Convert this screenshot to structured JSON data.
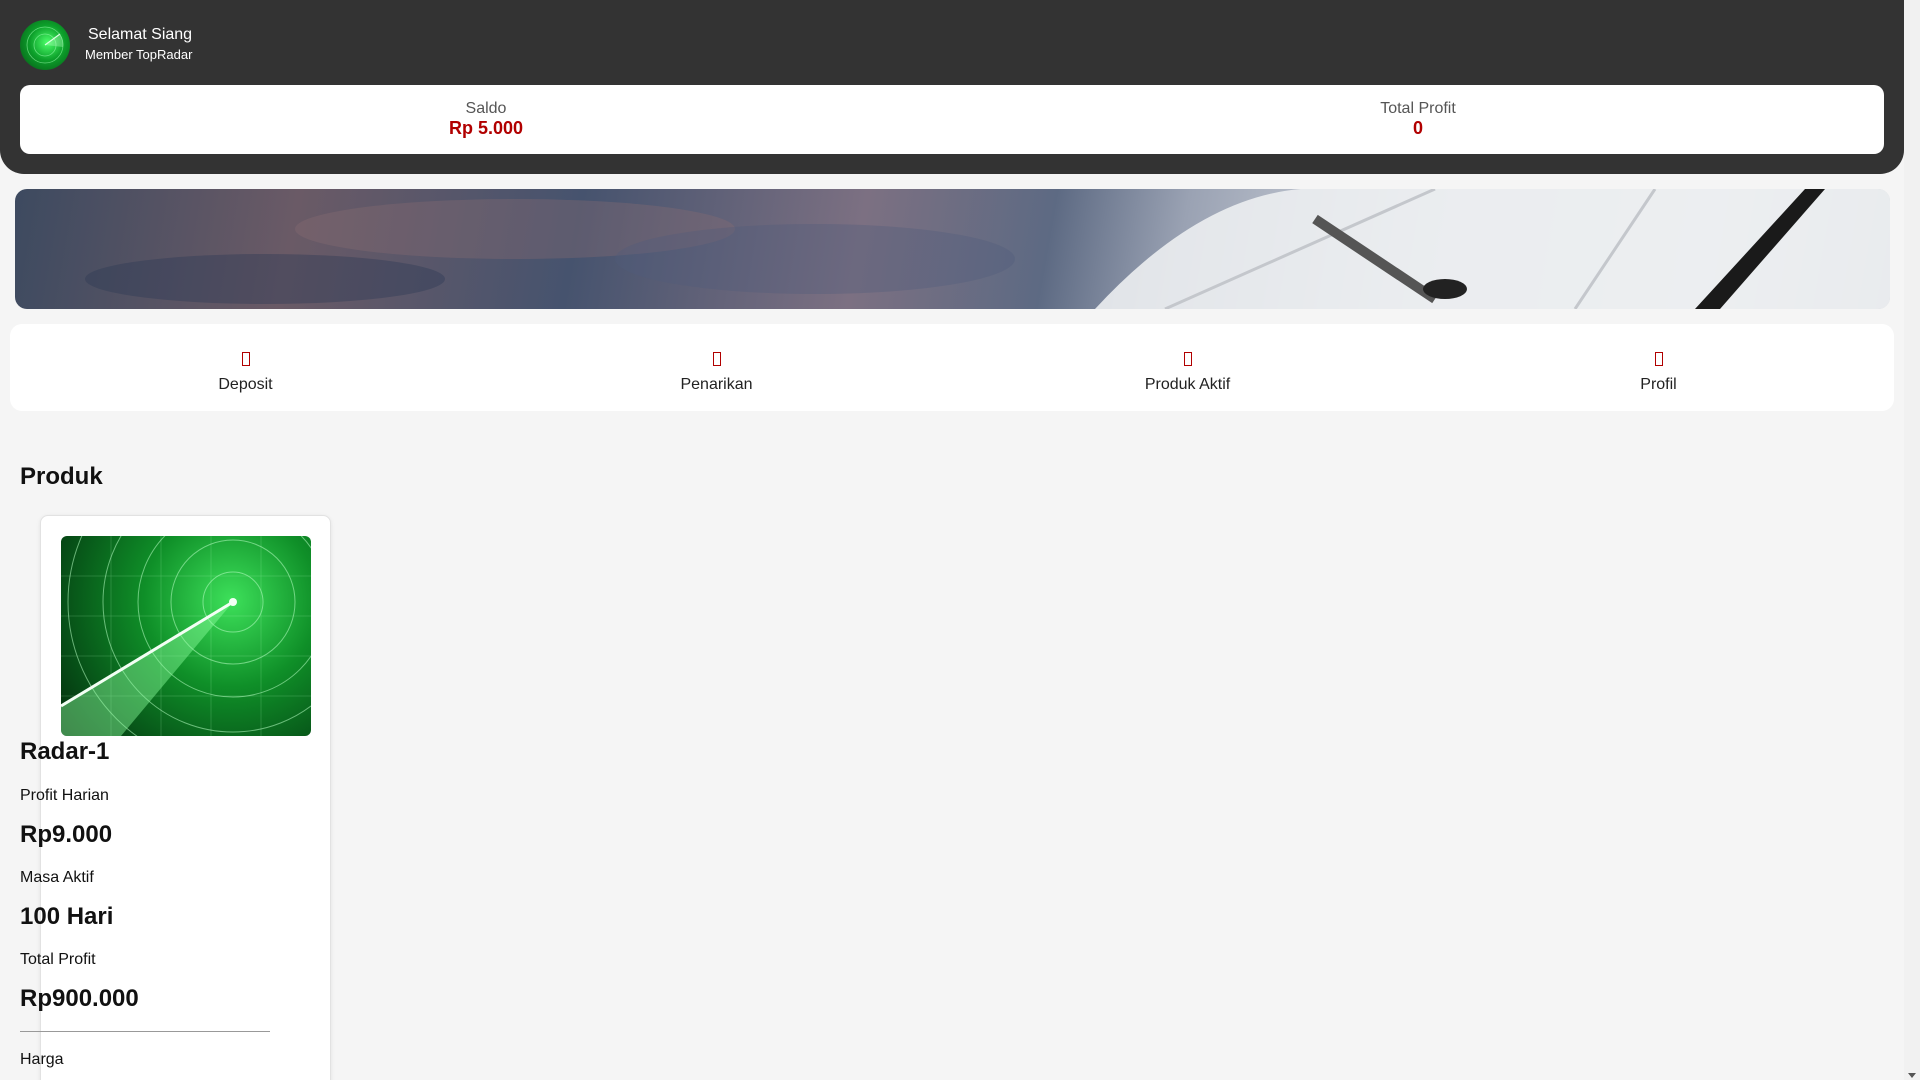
{
  "header": {
    "greeting": "Selamat Siang",
    "member": "Member TopRadar"
  },
  "stats": {
    "saldo_label": "Saldo",
    "saldo_value": "Rp 5.000",
    "profit_label": "Total Profit",
    "profit_value": "0"
  },
  "menu": {
    "items": [
      {
        "label": "Deposit"
      },
      {
        "label": "Penarikan"
      },
      {
        "label": "Produk Aktif"
      },
      {
        "label": "Profil"
      }
    ]
  },
  "products_section": {
    "title": "Produk",
    "items": [
      {
        "name": "Radar-1",
        "daily_profit_label": "Profit Harian",
        "daily_profit_value": "Rp9.000",
        "active_label": "Masa Aktif",
        "active_value": "100 Hari",
        "total_profit_label": "Total Profit",
        "total_profit_value": "Rp900.000",
        "price_label": "Harga"
      }
    ]
  },
  "colors": {
    "header_bg": "#333333",
    "accent_red": "#b10000",
    "radar_green": "#12a834"
  }
}
